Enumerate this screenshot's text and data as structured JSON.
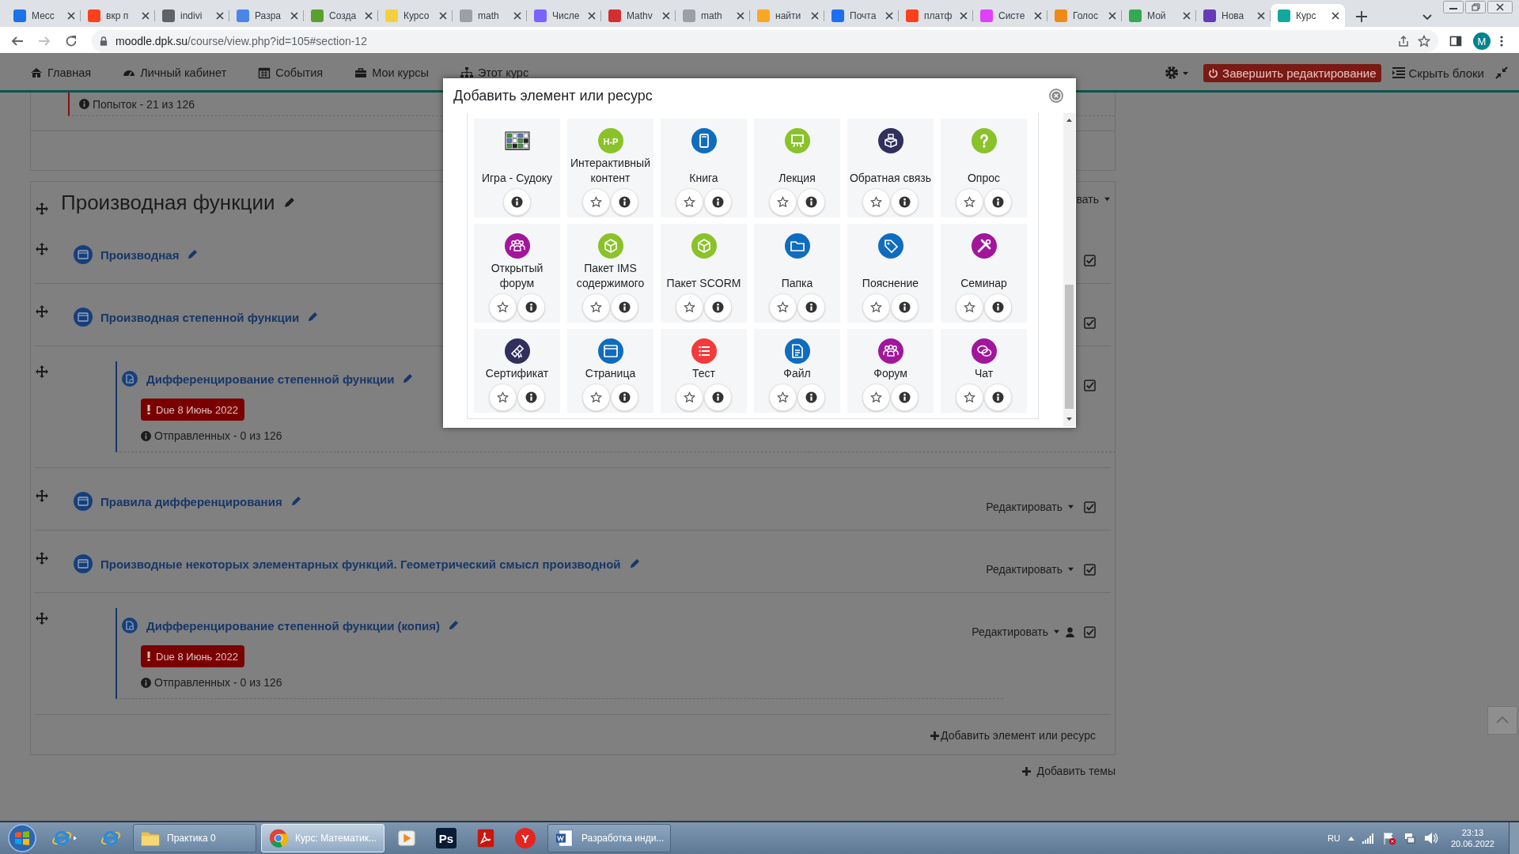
{
  "browser": {
    "tabs": [
      {
        "title": "Месс",
        "color": "#1a73e8",
        "selected": false
      },
      {
        "title": "вкр п",
        "color": "#fc3f1d",
        "selected": false
      },
      {
        "title": "indivi",
        "color": "#5f6368",
        "selected": false
      },
      {
        "title": "Разра",
        "color": "#4a86e8",
        "selected": false
      },
      {
        "title": "Созда",
        "color": "#5aa02c",
        "selected": false
      },
      {
        "title": "Курсо",
        "color": "#f4d03f",
        "selected": false
      },
      {
        "title": "math",
        "color": "#9aa0a6",
        "selected": false
      },
      {
        "title": "Числе",
        "color": "#7b61ff",
        "selected": false
      },
      {
        "title": "Mathv",
        "color": "#d32f2f",
        "selected": false
      },
      {
        "title": "math",
        "color": "#9aa0a6",
        "selected": false
      },
      {
        "title": "найти",
        "color": "#f9a825",
        "selected": false
      },
      {
        "title": "Почта",
        "color": "#1e6ff0",
        "selected": false
      },
      {
        "title": "платф",
        "color": "#fc3f1d",
        "selected": false
      },
      {
        "title": "Систе",
        "color": "#e040fb",
        "selected": false
      },
      {
        "title": "Голос",
        "color": "#ef8a17",
        "selected": false
      },
      {
        "title": "Мой",
        "color": "#34a853",
        "selected": false
      },
      {
        "title": "Нова",
        "color": "#673ab7",
        "selected": false
      },
      {
        "title": "Курс",
        "color": "#13a89e",
        "selected": true
      }
    ],
    "url": {
      "host": "moodle.dpk.su",
      "path": "/course/view.php?id=105#section-12"
    },
    "profile": "M"
  },
  "navbar": {
    "items": [
      {
        "label": "Главная",
        "kind": "home"
      },
      {
        "label": "Личный кабинет",
        "kind": "gauge"
      },
      {
        "label": "События",
        "kind": "calendar"
      },
      {
        "label": "Мои курсы",
        "kind": "briefcase"
      },
      {
        "label": "Этот курс",
        "kind": "sitemap"
      }
    ],
    "edit_button": "Завершить редактирование",
    "blocks_button": "Скрыть блоки"
  },
  "course": {
    "previous": {
      "info": "Попыток - 21 из 126"
    },
    "section": {
      "title": "Производная функции",
      "edit_menu": "вать",
      "activities": [
        {
          "kind": "page",
          "title": "Производная",
          "checked": true
        },
        {
          "kind": "page",
          "title": "Производная степенной функции",
          "checked": true
        },
        {
          "kind": "assignment",
          "title": "Дифференцирование степенной функции",
          "due": "Due 8 Июнь 2022",
          "info": "Отправленных - 0 из 126",
          "checked": true
        },
        {
          "kind": "page",
          "title": "Правила дифференцирования",
          "edit_menu": "Редактировать",
          "checked": true
        },
        {
          "kind": "page",
          "title": "Производные некоторых элементарных функций. Геометрический смысл производной",
          "edit_menu": "Редактировать",
          "checked": true
        },
        {
          "kind": "assignment",
          "title": "Дифференцирование степенной функции (копия)",
          "due": "Due 8 Июнь 2022",
          "info": "Отправленных - 0 из 126",
          "edit_menu": "Редактировать",
          "user_icon": true,
          "checked": true
        }
      ],
      "add_activity": "Добавить элемент или ресурс"
    },
    "add_section": "Добавить темы"
  },
  "modal": {
    "title": "Добавить элемент или ресурс",
    "items": [
      {
        "label": "Игра - Судоку",
        "kind": "sudoku"
      },
      {
        "label": "Интерактивный контент",
        "kind": "logo",
        "glyph": "H-P",
        "color": "#8ac22a",
        "starred": false
      },
      {
        "label": "Книга",
        "kind": "book",
        "color": "#0f6cbf",
        "starred": false
      },
      {
        "label": "Лекция",
        "kind": "lecture",
        "color": "#8ac22a",
        "starred": false
      },
      {
        "label": "Обратная связь",
        "kind": "feedback",
        "color": "#312f5e",
        "starred": false
      },
      {
        "label": "Опрос",
        "kind": "choice",
        "color": "#8ac22a",
        "starred": false
      },
      {
        "label": "Открытый форум",
        "kind": "forum",
        "color": "#a1169b",
        "starred": false
      },
      {
        "label": "Пакет IMS содержимого",
        "kind": "cube",
        "color": "#8ac22a",
        "starred": false
      },
      {
        "label": "Пакет SCORM",
        "kind": "cube",
        "color": "#8ac22a",
        "starred": false
      },
      {
        "label": "Папка",
        "kind": "folder",
        "color": "#0f6cbf",
        "starred": false
      },
      {
        "label": "Пояснение",
        "kind": "tag",
        "color": "#0f6cbf",
        "starred": false
      },
      {
        "label": "Семинар",
        "kind": "tools",
        "color": "#a1169b",
        "starred": false
      },
      {
        "label": "Сертификат",
        "kind": "certificate",
        "color": "#312f5e",
        "starred": false
      },
      {
        "label": "Страница",
        "kind": "page",
        "color": "#0f6cbf",
        "starred": false
      },
      {
        "label": "Тест",
        "kind": "quiz",
        "color": "#f43a3a",
        "starred": false
      },
      {
        "label": "Файл",
        "kind": "file",
        "color": "#0f6cbf",
        "starred": false
      },
      {
        "label": "Форум",
        "kind": "forum",
        "color": "#a1169b",
        "starred": false
      },
      {
        "label": "Чат",
        "kind": "chat",
        "color": "#a1169b",
        "starred": false
      }
    ]
  },
  "taskbar": {
    "items": [
      {
        "kind": "ie_jump",
        "selected": false
      },
      {
        "kind": "ie",
        "selected": false
      },
      {
        "kind": "folder",
        "label": "Практика 0",
        "selected": false
      },
      {
        "kind": "chrome",
        "label": "Курс: Математик...",
        "selected": true
      },
      {
        "kind": "media",
        "selected": false
      },
      {
        "kind": "glyph",
        "glyph": "Ps",
        "color": "#0a1c33",
        "selected": false
      },
      {
        "kind": "pdf",
        "selected": false
      },
      {
        "kind": "glyph",
        "glyph": "Y",
        "color": "#e52620",
        "selected": false
      },
      {
        "kind": "word",
        "label": "Разработка инди...",
        "selected": false
      }
    ],
    "language": "RU",
    "time": "23:13",
    "date": "20.06.2022"
  }
}
